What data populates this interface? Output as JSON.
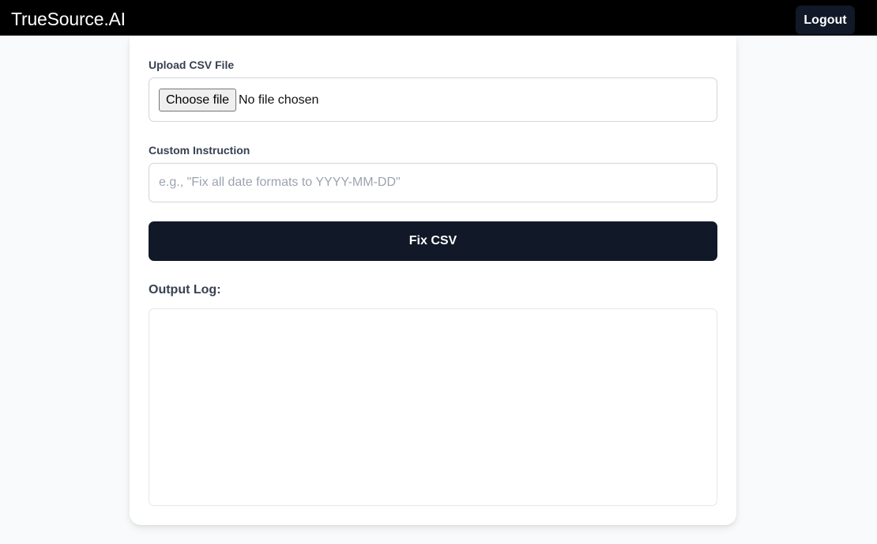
{
  "header": {
    "brand": "TrueSource.AI",
    "logout_label": "Logout"
  },
  "form": {
    "upload_label": "Upload CSV File",
    "choose_file_label": "Choose file",
    "file_status": "No file chosen",
    "instruction_label": "Custom Instruction",
    "instruction_value": "",
    "instruction_placeholder": "e.g., \"Fix all date formats to YYYY-MM-DD\"",
    "submit_label": "Fix CSV"
  },
  "output": {
    "label": "Output Log:",
    "content": ""
  },
  "colors": {
    "topbar": "#000000",
    "primary_button": "#111827",
    "page_background": "#f9fafb"
  }
}
